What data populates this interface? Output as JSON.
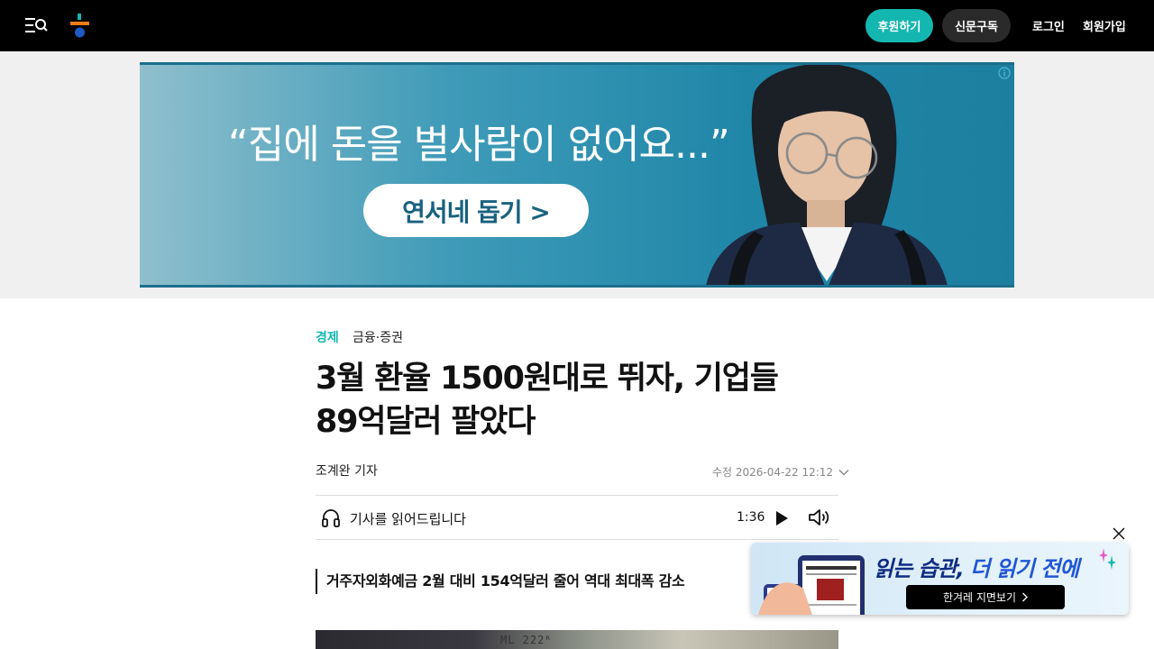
{
  "header": {
    "support_label": "후원하기",
    "subscribe_label": "신문구독",
    "login_label": "로그인",
    "signup_label": "회원가입"
  },
  "ad": {
    "quote": "“집에 돈을 벌사람이 없어요...”",
    "cta": "연서네 돕기 >"
  },
  "article": {
    "category": "경제",
    "subcategory": "금융·증권",
    "headline_line1": "3월 환율 1500원대로 뛰자, 기업들",
    "headline_line2": "89억달러 팔았다",
    "author": "조계완 기자",
    "modified": "수정 2026-04-22 12:12",
    "tts_label": "기사를 읽어드립니다",
    "tts_time": "1:36",
    "subhead": "거주자외화예금 2월 대비 154억달러 줄어 역대 최대폭 감소",
    "photo_text": "ML 222ᴿ"
  },
  "promo": {
    "title_dark": "읽는 습관,",
    "title_light": " 더 읽기 전에",
    "button_label": "한겨레 지면보기"
  },
  "colors": {
    "accent": "#14b7b0",
    "header_bg": "#000000",
    "promo_title": "#0f2c83"
  }
}
